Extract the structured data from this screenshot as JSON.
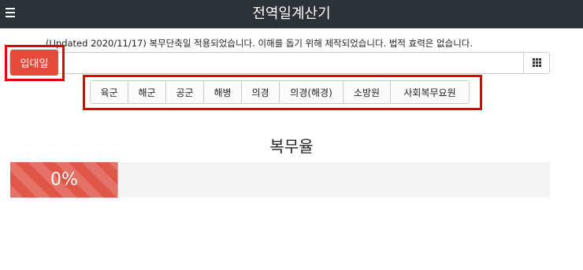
{
  "header": {
    "title": "전역일계산기",
    "menu_icon": "hamburger-menu-icon"
  },
  "notice": "(Updated 2020/11/17) 복무단축일 적용되었습니다. 이해를 돕기 위해 제작되었습니다. 법적 효력은 없습니다.",
  "date_input": {
    "enlist_label": "입대일",
    "value": "",
    "calendar_icon": "grid-icon"
  },
  "service_branches": [
    "육군",
    "해군",
    "공군",
    "해병",
    "의경",
    "의경(해경)",
    "소방원",
    "사회복무요원"
  ],
  "progress": {
    "title": "복무율",
    "label": "0%",
    "percent": 0,
    "bar_color": "#e0574a"
  },
  "colors": {
    "navbar": "#2d3238",
    "accent": "#e64a3b",
    "highlight": "#e80000"
  }
}
